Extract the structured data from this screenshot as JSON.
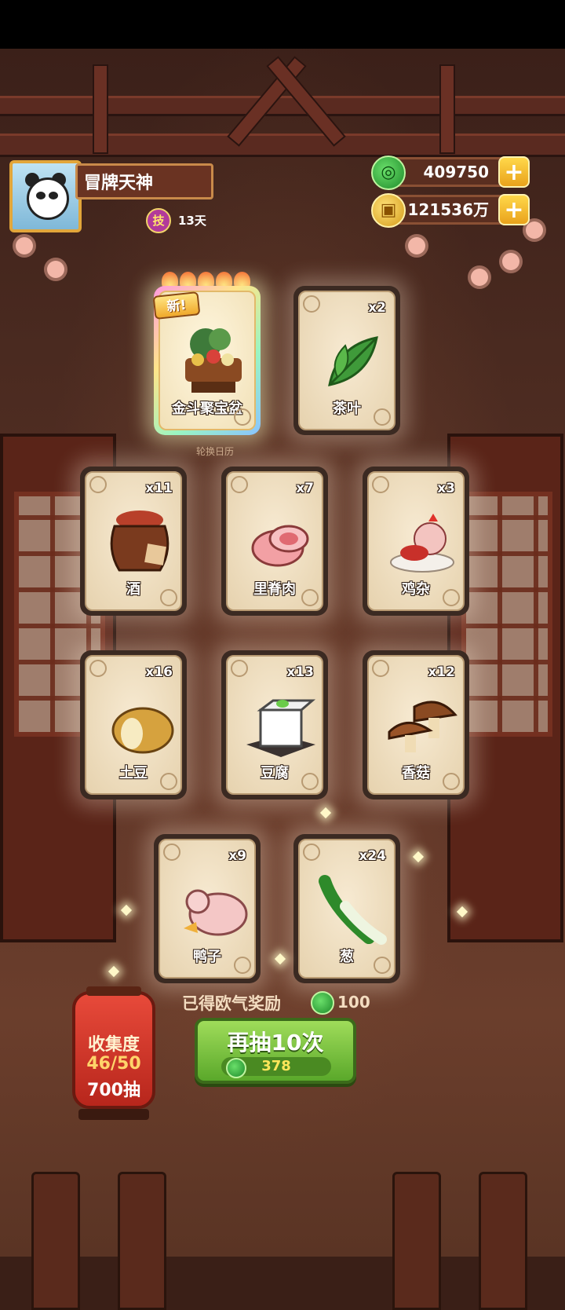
{
  "player": {
    "name": "冒牌天神",
    "skill_badge": "技",
    "days": "13天"
  },
  "currencies": [
    {
      "icon": "jade-coin-icon",
      "value": "409750",
      "plus": "+"
    },
    {
      "icon": "gold-coin-icon",
      "value": "121536万",
      "plus": "+"
    }
  ],
  "featured": {
    "badge": "新!",
    "calendar_tag": "轮换日历"
  },
  "cards": [
    {
      "label": "金斗聚宝盆",
      "count": "",
      "icon": "treasure-bowl-icon"
    },
    {
      "label": "茶叶",
      "count": "x2",
      "icon": "tea-leaf-icon"
    },
    {
      "label": "酒",
      "count": "x11",
      "icon": "wine-jar-icon"
    },
    {
      "label": "里脊肉",
      "count": "x7",
      "icon": "tenderloin-icon"
    },
    {
      "label": "鸡杂",
      "count": "x3",
      "icon": "chicken-giblets-icon"
    },
    {
      "label": "土豆",
      "count": "x16",
      "icon": "potato-icon"
    },
    {
      "label": "豆腐",
      "count": "x13",
      "icon": "tofu-icon"
    },
    {
      "label": "香菇",
      "count": "x12",
      "icon": "mushroom-icon"
    },
    {
      "label": "鸭子",
      "count": "x9",
      "icon": "duck-icon"
    },
    {
      "label": "葱",
      "count": "x24",
      "icon": "scallion-icon"
    }
  ],
  "reward": {
    "text": "已得欧气奖励",
    "value": "100"
  },
  "draw_button": {
    "label": "再抽10次",
    "cost": "378"
  },
  "collection": {
    "title": "收集度",
    "progress": "46/50",
    "draws": "700抽"
  },
  "colors": {
    "jade": "#2fa83a",
    "gold": "#f0b028",
    "button_green": "#6fbf34",
    "lantern_red": "#d43a2c"
  }
}
